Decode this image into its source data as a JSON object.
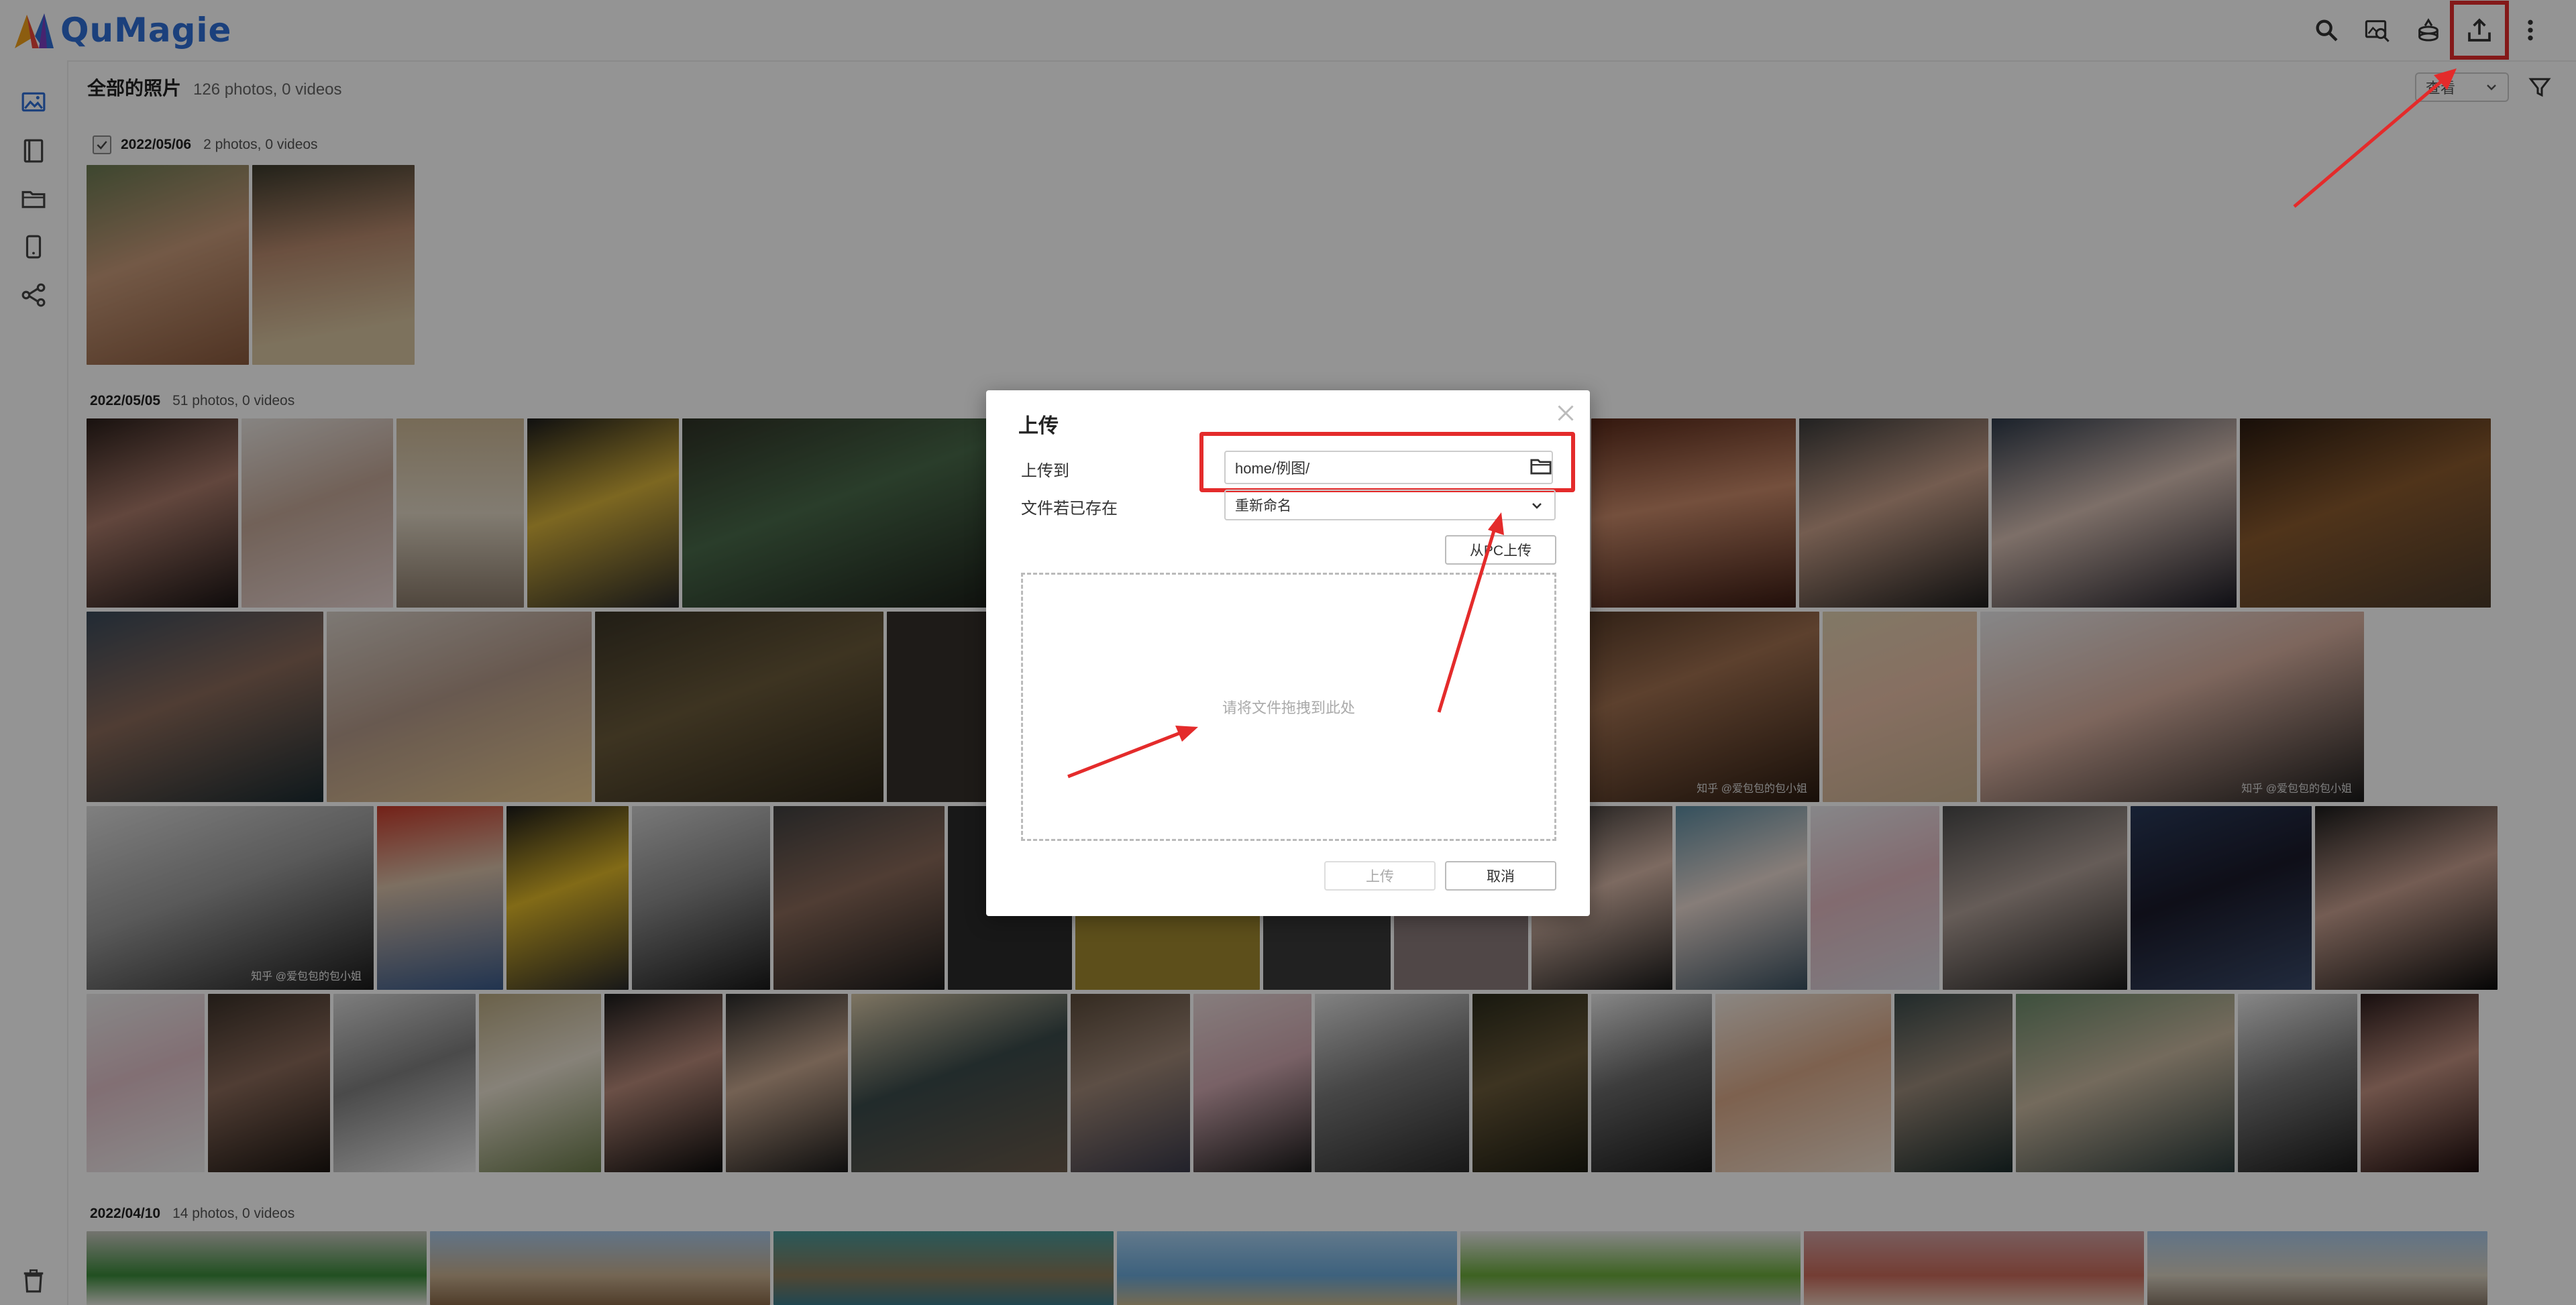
{
  "app": {
    "name": "QuMagie",
    "page_title": "全部的照片",
    "page_count": "126 photos, 0 videos",
    "sort_label": "查看"
  },
  "groups": [
    {
      "date": "2022/05/06",
      "count": "2 photos, 0 videos"
    },
    {
      "date": "2022/05/05",
      "count": "51 photos, 0 videos"
    },
    {
      "date": "2022/04/10",
      "count": "14 photos, 0 videos"
    }
  ],
  "watermarks": [
    "知乎 @爱包包的包小姐",
    "知乎 @爱包包的包小姐",
    "知乎 @爱包包的包小姐"
  ],
  "dialog": {
    "title": "上传",
    "upload_to_label": "上传到",
    "upload_path": "home/例图/",
    "if_exists_label": "文件若已存在",
    "if_exists_value": "重新命名",
    "upload_from_pc": "从PC上传",
    "drop_hint": "请将文件拖拽到此处",
    "upload_button": "上传",
    "cancel_button": "取消"
  },
  "colors": {
    "brand": "#2f6fd6",
    "annotation": "#e42b2b"
  }
}
